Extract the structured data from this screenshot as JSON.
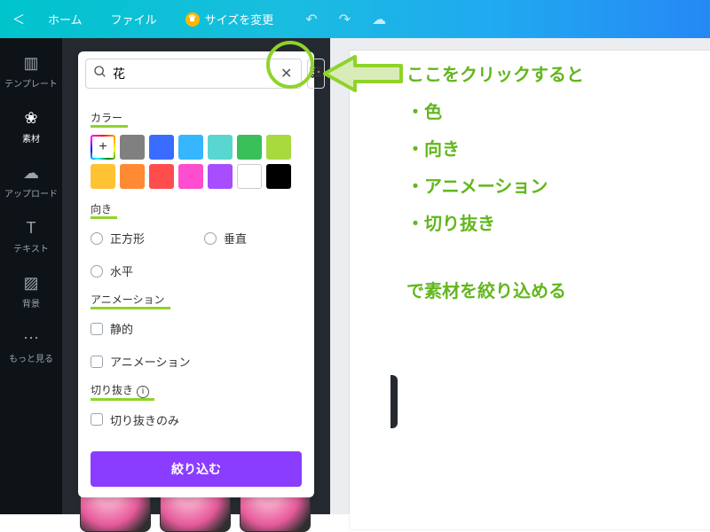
{
  "topbar": {
    "home": "ホーム",
    "file": "ファイル",
    "resize": "サイズを変更"
  },
  "sidebar": {
    "items": [
      {
        "label": "テンプレート"
      },
      {
        "label": "素材"
      },
      {
        "label": "アップロード"
      },
      {
        "label": "テキスト"
      },
      {
        "label": "背景"
      },
      {
        "label": "もっと見る"
      }
    ]
  },
  "search": {
    "value": "花"
  },
  "filters": {
    "color_label": "カラー",
    "orientation_label": "向き",
    "orientation_opts": {
      "square": "正方形",
      "vertical": "垂直",
      "horizontal": "水平"
    },
    "animation_label": "アニメーション",
    "animation_opts": {
      "static": "静的",
      "animated": "アニメーション"
    },
    "cutout_label": "切り抜き",
    "cutout_opt": "切り抜きのみ",
    "apply": "絞り込む",
    "swatches": [
      "#808080",
      "#3a6cff",
      "#35b6ff",
      "#5ad6d0",
      "#3bbf5a",
      "#a8d93f",
      "#ffc233",
      "#ff8a33",
      "#ff4d4d",
      "#ff4dcf",
      "#a84dff",
      "#ffffff",
      "#000000"
    ]
  },
  "annotation": {
    "line1": "ここをクリックすると",
    "b1": "・色",
    "b2": "・向き",
    "b3": "・アニメーション",
    "b4": "・切り抜き",
    "line2": "で素材を絞り込める"
  }
}
